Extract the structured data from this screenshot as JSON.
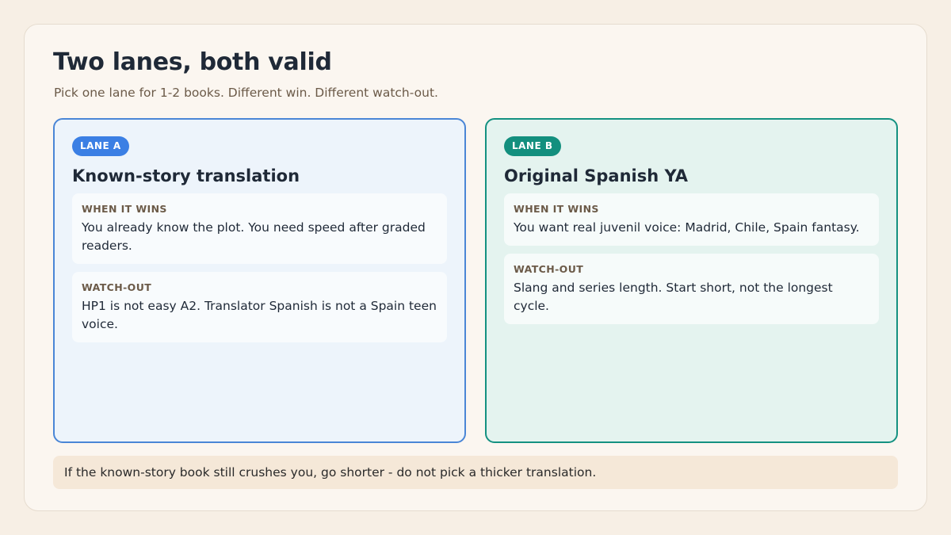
{
  "header": {
    "title": "Two lanes, both valid",
    "subtitle": "Pick one lane for 1-2 books. Different win. Different watch-out."
  },
  "lanes": [
    {
      "badge": "LANE A",
      "title": "Known-story translation",
      "wins_label": "WHEN IT WINS",
      "wins_text": "You already know the plot. You need speed after graded readers.",
      "watch_label": "WATCH-OUT",
      "watch_text": "HP1 is not easy A2. Translator Spanish is not a Spain teen voice."
    },
    {
      "badge": "LANE B",
      "title": "Original Spanish YA",
      "wins_label": "WHEN IT WINS",
      "wins_text": "You want real juvenil voice: Madrid, Chile, Spain fantasy.",
      "watch_label": "WATCH-OUT",
      "watch_text": "Slang and series length. Start short, not the longest cycle."
    }
  ],
  "footer_note": "If the known-story book still crushes you, go shorter - do not pick a thicker translation.",
  "colors": {
    "lane_a_accent": "#3b7fe4",
    "lane_b_accent": "#138f7e",
    "page_bg": "#f7efe5",
    "note_bg": "#f5e8d8"
  }
}
